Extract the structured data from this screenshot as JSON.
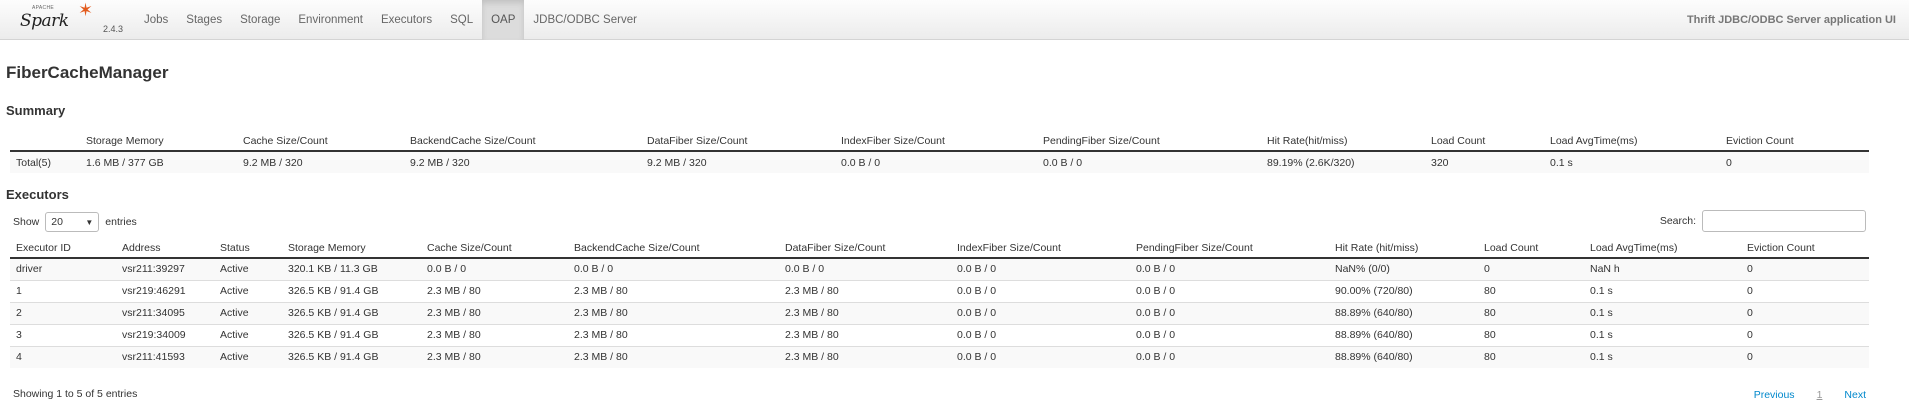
{
  "brand": {
    "apache": "APACHE",
    "name": "Spark",
    "version": "2.4.3"
  },
  "nav": [
    {
      "label": "Jobs"
    },
    {
      "label": "Stages"
    },
    {
      "label": "Storage"
    },
    {
      "label": "Environment"
    },
    {
      "label": "Executors"
    },
    {
      "label": "SQL"
    },
    {
      "label": "OAP",
      "active": true
    },
    {
      "label": "JDBC/ODBC Server"
    }
  ],
  "app_name": "Thrift JDBC/ODBC Server application UI",
  "page_title": "FiberCacheManager",
  "summary": {
    "heading": "Summary",
    "columns": [
      "",
      "Storage Memory",
      "Cache Size/Count",
      "BackendCache Size/Count",
      "DataFiber Size/Count",
      "IndexFiber Size/Count",
      "PendingFiber Size/Count",
      "Hit Rate(hit/miss)",
      "Load Count",
      "Load AvgTime(ms)",
      "Eviction Count"
    ],
    "rows": [
      [
        "Total(5)",
        "1.6 MB / 377 GB",
        "9.2 MB / 320",
        "9.2 MB / 320",
        "9.2 MB / 320",
        "0.0 B / 0",
        "0.0 B / 0",
        "89.19% (2.6K/320)",
        "320",
        "0.1 s",
        "0"
      ]
    ]
  },
  "executors": {
    "heading": "Executors",
    "show_label": "Show",
    "entries_label": "entries",
    "page_size": "20",
    "search_label": "Search:",
    "search_value": "",
    "columns": [
      "Executor ID",
      "Address",
      "Status",
      "Storage Memory",
      "Cache Size/Count",
      "BackendCache Size/Count",
      "DataFiber Size/Count",
      "IndexFiber Size/Count",
      "PendingFiber Size/Count",
      "Hit Rate (hit/miss)",
      "Load Count",
      "Load AvgTime(ms)",
      "Eviction Count"
    ],
    "rows": [
      [
        "driver",
        "vsr211:39297",
        "Active",
        "320.1 KB / 11.3 GB",
        "0.0 B / 0",
        "0.0 B / 0",
        "0.0 B / 0",
        "0.0 B / 0",
        "0.0 B / 0",
        "NaN% (0/0)",
        "0",
        "NaN h",
        "0"
      ],
      [
        "1",
        "vsr219:46291",
        "Active",
        "326.5 KB / 91.4 GB",
        "2.3 MB / 80",
        "2.3 MB / 80",
        "2.3 MB / 80",
        "0.0 B / 0",
        "0.0 B / 0",
        "90.00% (720/80)",
        "80",
        "0.1 s",
        "0"
      ],
      [
        "2",
        "vsr211:34095",
        "Active",
        "326.5 KB / 91.4 GB",
        "2.3 MB / 80",
        "2.3 MB / 80",
        "2.3 MB / 80",
        "0.0 B / 0",
        "0.0 B / 0",
        "88.89% (640/80)",
        "80",
        "0.1 s",
        "0"
      ],
      [
        "3",
        "vsr219:34009",
        "Active",
        "326.5 KB / 91.4 GB",
        "2.3 MB / 80",
        "2.3 MB / 80",
        "2.3 MB / 80",
        "0.0 B / 0",
        "0.0 B / 0",
        "88.89% (640/80)",
        "80",
        "0.1 s",
        "0"
      ],
      [
        "4",
        "vsr211:41593",
        "Active",
        "326.5 KB / 91.4 GB",
        "2.3 MB / 80",
        "2.3 MB / 80",
        "2.3 MB / 80",
        "0.0 B / 0",
        "0.0 B / 0",
        "88.89% (640/80)",
        "80",
        "0.1 s",
        "0"
      ]
    ],
    "info": "Showing 1 to 5 of 5 entries",
    "pager": {
      "previous": "Previous",
      "page": "1",
      "next": "Next"
    }
  },
  "colors": {
    "accent": "#e25a1c",
    "link": "#0088cc"
  }
}
